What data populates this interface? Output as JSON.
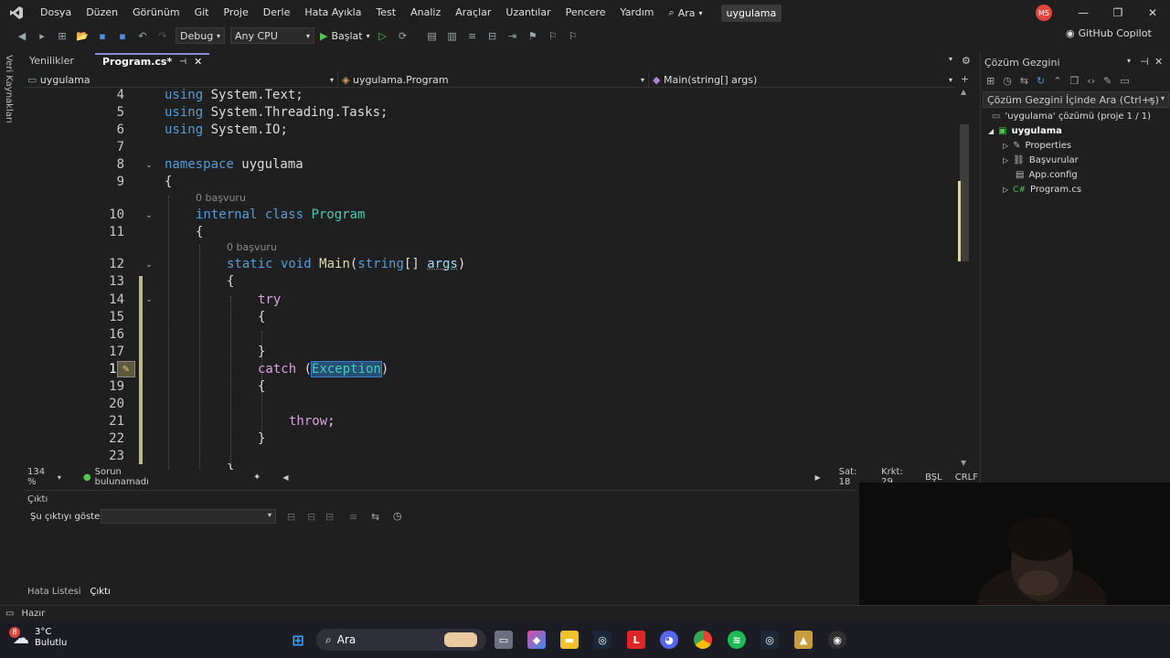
{
  "menubar": {
    "items": [
      "Dosya",
      "Düzen",
      "Görünüm",
      "Git",
      "Proje",
      "Derle",
      "Hata Ayıkla",
      "Test",
      "Analiz",
      "Araçlar",
      "Uzantılar",
      "Pencere",
      "Yardım"
    ],
    "search_label": "Ara",
    "solution_name": "uygulama",
    "avatar_initials": "MS"
  },
  "toolbar": {
    "config": "Debug",
    "platform": "Any CPU",
    "start_label": "Başlat",
    "copilot_label": "GitHub Copilot"
  },
  "left_strip": {
    "label": "Veri Kaynakları"
  },
  "tabs": [
    {
      "label": "Yenilikler"
    },
    {
      "label": "Program.cs*"
    }
  ],
  "navbar": {
    "project": "uygulama",
    "class": "uygulama.Program",
    "member": "Main(string[] args)"
  },
  "editor": {
    "codelens_1": "0 başvuru",
    "codelens_2": "0 başvuru",
    "line_numbers": [
      "4",
      "5",
      "6",
      "7",
      "8",
      "9",
      "10",
      "11",
      "12",
      "13",
      "14",
      "15",
      "16",
      "17",
      "18",
      "19",
      "20",
      "21",
      "22",
      "23"
    ]
  },
  "editor_status": {
    "zoom": "134 %",
    "issues": "Sorun bulunamadı",
    "line": "Sat: 18",
    "col": "Krkt: 29",
    "mode": "BŞL",
    "eol": "CRLF"
  },
  "output": {
    "title": "Çıktı",
    "show_label": "Şu çıktıyı göster:",
    "tabs": [
      "Hata Listesi",
      "Çıktı"
    ]
  },
  "solution_explorer": {
    "title": "Çözüm Gezgini",
    "search_placeholder": "Çözüm Gezgini İçinde Ara (Ctrl+ş)",
    "solution": "'uygulama' çözümü (proje 1 / 1)",
    "project": "uygulama",
    "items": [
      "Properties",
      "Başvurular",
      "App.config",
      "Program.cs"
    ]
  },
  "statusbar": {
    "text": "Hazır"
  },
  "taskbar": {
    "temp": "3°C",
    "weather": "Bulutlu",
    "badge": "8",
    "search": "Ara"
  }
}
